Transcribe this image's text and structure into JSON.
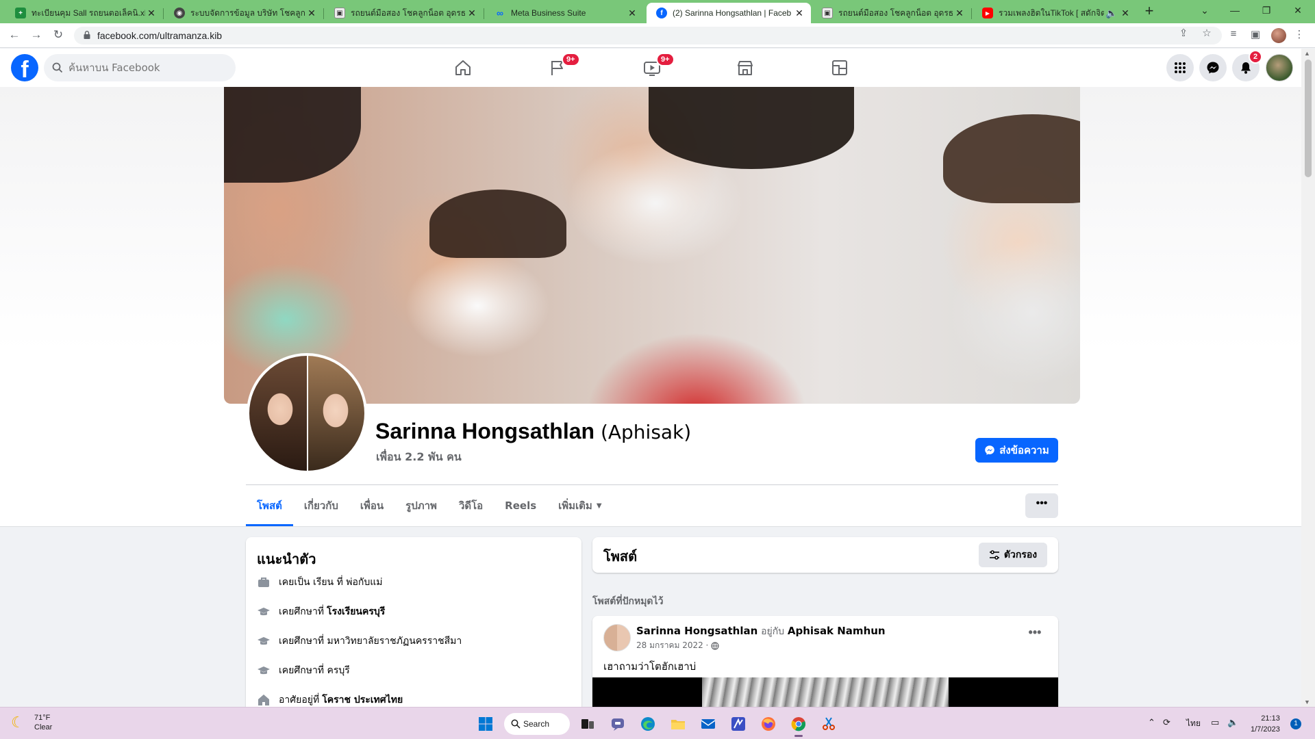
{
  "browser": {
    "tabs": [
      {
        "title": "ทะเบียนคุม Sall รถยนตอเล็คนิ.xlsx - G",
        "icon": "sheets-icon",
        "color": "#1e8e3e"
      },
      {
        "title": "ระบบจัดการข้อมูล บริษัท โชคลูกน็อต",
        "icon": "globe-icon",
        "color": "#444444"
      },
      {
        "title": "รถยนต์มือสอง โชคลูกน็อต อุดรธานี",
        "icon": "site-icon",
        "color": "#555555"
      },
      {
        "title": "Meta Business Suite",
        "icon": "meta-icon",
        "color": "#0866ff"
      },
      {
        "title": "(2) Sarinna Hongsathlan | Faceb",
        "icon": "facebook-icon",
        "color": "#0866ff"
      },
      {
        "title": "รถยนต์มือสอง โชคลูกน็อต อุดรธานี",
        "icon": "site-icon",
        "color": "#555555"
      },
      {
        "title": "รวมเพลงฮิตในTikTok [ สดักจิต...",
        "icon": "youtube-icon",
        "color": "#ff0000"
      }
    ],
    "url": "facebook.com/ultramanza.kib"
  },
  "facebook": {
    "search_placeholder": "ค้นหาบน Facebook",
    "nav_badges": {
      "pages": "9+",
      "watch": "9+"
    },
    "notifications_badge": "2"
  },
  "profile": {
    "name": "Sarinna Hongsathlan",
    "alternate_name": "(Aphisak)",
    "friends": "เพื่อน 2.2 พัน คน",
    "message_button": "ส่งข้อความ",
    "tabs": [
      "โพสต์",
      "เกี่ยวกับ",
      "เพื่อน",
      "รูปภาพ",
      "วิดีโอ",
      "Reels",
      "เพิ่มเติม"
    ],
    "more_button": "•••"
  },
  "intro": {
    "title": "แนะนำตัว",
    "items": [
      {
        "icon": "briefcase-icon",
        "prefix": "เคยเป็น เรียน ที่ พ่อกับแม่",
        "bold": ""
      },
      {
        "icon": "graduation-cap-icon",
        "prefix": "เคยศึกษาที่",
        "bold": "โรงเรียนครบุรี"
      },
      {
        "icon": "graduation-cap-icon",
        "prefix": "เคยศึกษาที่ มหาวิทยาลัยราชภัฏนครราชสีมา",
        "bold": ""
      },
      {
        "icon": "graduation-cap-icon",
        "prefix": "เคยศึกษาที่ ครบุรี",
        "bold": ""
      },
      {
        "icon": "home-icon",
        "prefix": "อาศัยอยู่ที่",
        "bold": "โคราช ประเทศไทย"
      }
    ]
  },
  "posts": {
    "title": "โพสต์",
    "filter_button": "ตัวกรอง",
    "pinned_label": "โพสต์ที่ปักหมุดไว้",
    "post": {
      "author": "Sarinna Hongsathlan",
      "with_label": "อยู่กับ",
      "with_name": "Aphisak Namhun",
      "date": "28 มกราคม 2022 ·",
      "text": "เฮาถามว่าโตฮักเฮาบ่"
    }
  },
  "taskbar": {
    "temp": "71°F",
    "weather": "Clear",
    "search": "Search",
    "lang": "ไทย",
    "time": "21:13",
    "date": "1/7/2023",
    "notification_count": "1"
  }
}
